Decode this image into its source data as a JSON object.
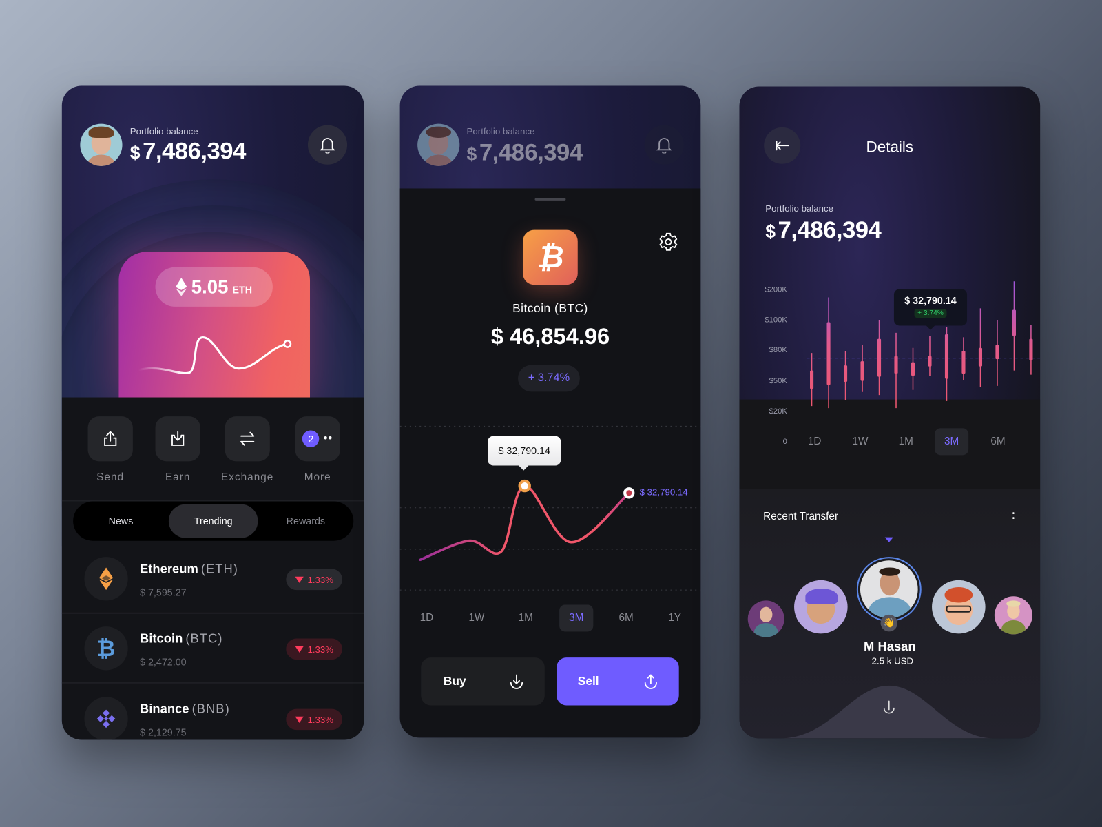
{
  "colors": {
    "accent": "#6f5cff",
    "negative": "#ff3b5c",
    "positive": "#2fd06a",
    "eth_orange": "#f7a046",
    "btc_blue": "#5b9bdc",
    "bnb_purple": "#7a6ff0"
  },
  "left": {
    "portfolio_label": "Portfolio balance",
    "currency": "$",
    "balance": "7,486,394",
    "eth_amount": "5.05",
    "eth_unit": "ETH",
    "actions": [
      {
        "label": "Send",
        "icon": "upload-share-icon"
      },
      {
        "label": "Earn",
        "icon": "download-tray-icon"
      },
      {
        "label": "Exchange",
        "icon": "swap-arrows-icon"
      },
      {
        "label": "More",
        "icon": "more-dots-icon",
        "badge": "2"
      }
    ],
    "tabs": [
      "News",
      "Trending",
      "Rewards"
    ],
    "active_tab": "Trending",
    "coins": [
      {
        "name": "Ethereum",
        "ticker": "(ETH)",
        "price": "$ 7,595.27",
        "change": "1.33%",
        "icon": "ethereum-icon"
      },
      {
        "name": "Bitcoin",
        "ticker": "(BTC)",
        "price": "$ 2,472.00",
        "change": "1.33%",
        "icon": "bitcoin-icon"
      },
      {
        "name": "Binance",
        "ticker": "(BNB)",
        "price": "$ 2,129.75",
        "change": "1.33%",
        "icon": "binance-icon"
      }
    ]
  },
  "middle": {
    "portfolio_label": "Portfolio balance",
    "currency": "$",
    "balance": "7,486,394",
    "coin_title": "Bitcoin (BTC)",
    "price": "$ 46,854.96",
    "change": "+ 3.74%",
    "tooltip": "$ 32,790.14",
    "end_label": "$ 32,790.14",
    "timeframes": [
      "1D",
      "1W",
      "1M",
      "3M",
      "6M",
      "1Y"
    ],
    "active_timeframe": "3M",
    "buy": "Buy",
    "sell": "Sell"
  },
  "right": {
    "title": "Details",
    "portfolio_label": "Portfolio balance",
    "currency": "$",
    "balance": "7,486,394",
    "tooltip_price": "$ 32,790.14",
    "tooltip_change": "+ 3.74%",
    "timeframes": [
      "1D",
      "1W",
      "1M",
      "3M",
      "6M"
    ],
    "active_timeframe": "3M",
    "recent_title": "Recent Transfer",
    "selected_name": "M Hasan",
    "selected_amount": "2.5 k USD"
  },
  "chart_data": [
    {
      "type": "line",
      "title": "",
      "x": [
        0,
        21,
        35,
        45,
        65,
        90
      ],
      "values": [
        43,
        70,
        55,
        148,
        68,
        138
      ],
      "highlight_label": "$ 32,790.14",
      "end_label": "$ 32,790.14",
      "grid": true
    },
    {
      "type": "candlestick",
      "title": "",
      "y_ticks": [
        "$200K",
        "$100K",
        "$80K",
        "$50K",
        "$20K",
        "0"
      ],
      "y_tick_values": [
        200000,
        100000,
        80000,
        50000,
        20000,
        0
      ],
      "reference_line": 73000,
      "candles": [
        {
          "high": 78000,
          "low": 26000,
          "top": 61000,
          "bottom": 43000
        },
        {
          "high": 177000,
          "low": 24000,
          "top": 99000,
          "bottom": 47000
        },
        {
          "high": 80000,
          "low": 32000,
          "top": 66000,
          "bottom": 50000
        },
        {
          "high": 84000,
          "low": 40000,
          "top": 70000,
          "bottom": 51000
        },
        {
          "high": 102000,
          "low": 37000,
          "top": 88000,
          "bottom": 55000
        },
        {
          "high": 92000,
          "low": 24000,
          "top": 75000,
          "bottom": 58000
        },
        {
          "high": 82000,
          "low": 42000,
          "top": 69000,
          "bottom": 56000
        },
        {
          "high": 90000,
          "low": 56000,
          "top": 75000,
          "bottom": 65000
        },
        {
          "high": 96000,
          "low": 31000,
          "top": 91000,
          "bottom": 53000
        },
        {
          "high": 89000,
          "low": 52000,
          "top": 80000,
          "bottom": 58000
        },
        {
          "high": 141000,
          "low": 45000,
          "top": 82000,
          "bottom": 65000
        },
        {
          "high": 102000,
          "low": 46000,
          "top": 84000,
          "bottom": 72000
        },
        {
          "high": 230000,
          "low": 61000,
          "top": 136000,
          "bottom": 90000
        },
        {
          "high": 97000,
          "low": 57000,
          "top": 88000,
          "bottom": 71000
        }
      ]
    }
  ]
}
